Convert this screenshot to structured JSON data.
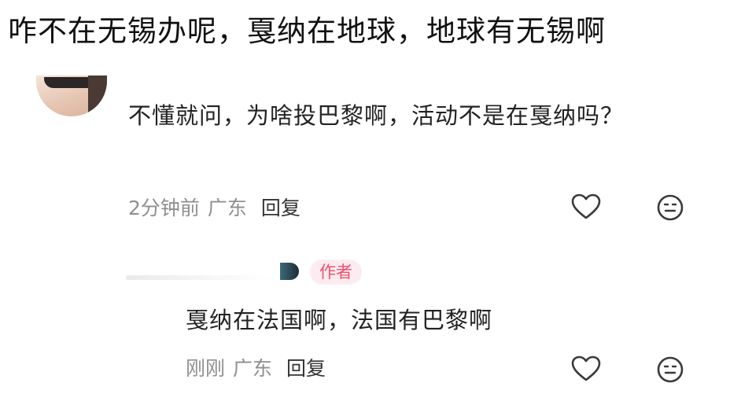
{
  "caption": "咋不在无锡办呢，戛纳在地球，地球有无锡啊",
  "comment": {
    "text": "不懂就问，为啥投巴黎啊，活动不是在戛纳吗？",
    "time": "2分钟前",
    "location": "广东",
    "reply_label": "回复"
  },
  "reply": {
    "author_tag": "作者",
    "text": "戛纳在法国啊，法国有巴黎啊",
    "time": "刚刚",
    "location": "广东",
    "reply_label": "回复"
  },
  "icons": {
    "like": "heart-outline-icon",
    "emoji": "smiley-face-icon"
  },
  "colors": {
    "author_tag_text": "#f0506e",
    "author_tag_bg": "#fdecef",
    "meta_text": "#8f8f8f",
    "icon_stroke": "#3a3a3a"
  }
}
